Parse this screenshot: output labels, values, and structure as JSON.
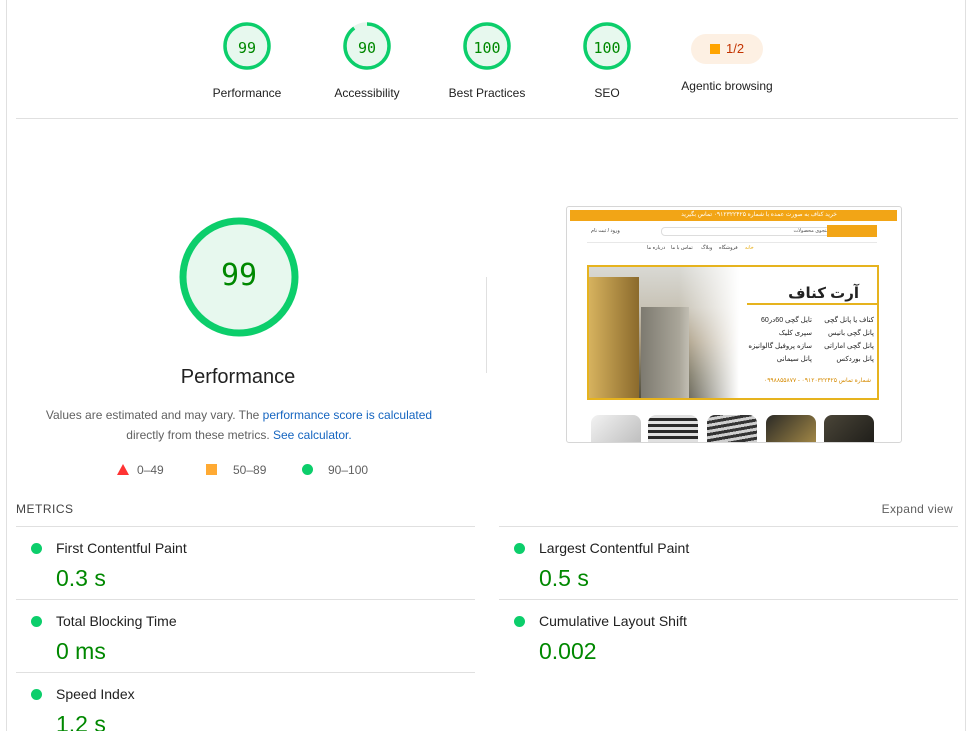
{
  "gauges": [
    {
      "score": "99",
      "label": "Performance",
      "color": "#0cce6b"
    },
    {
      "score": "90",
      "label": "Accessibility",
      "color": "#0cce6b"
    },
    {
      "score": "100",
      "label": "Best Practices",
      "color": "#0cce6b"
    },
    {
      "score": "100",
      "label": "SEO",
      "color": "#0cce6b"
    }
  ],
  "agentic": {
    "fraction": "1/2",
    "label": "Agentic browsing"
  },
  "main": {
    "score": "99",
    "title": "Performance",
    "note_prefix": "Values are estimated and may vary. The ",
    "note_link1": "performance score is calculated",
    "note_mid": "directly from these metrics. ",
    "note_link2": "See calculator.",
    "legend": [
      {
        "range": "0–49",
        "shape": "triangle",
        "color": "#ff3333"
      },
      {
        "range": "50–89",
        "shape": "square",
        "color": "#ffaa33"
      },
      {
        "range": "90–100",
        "shape": "circle",
        "color": "#0cce6b"
      }
    ]
  },
  "thumbnail": {
    "topbar_text": "خرید کناف به صورت عمده با شماره ۰۹۱۲۳۲۲۴۲۵ تماس بگیرید",
    "search_placeholder": "جستجوی محصولات",
    "login_text": "ورود / ثبت نام",
    "menu_items": [
      "خانه",
      "فروشگاه",
      "وبلاگ",
      "تماس با ما",
      "درباره ما"
    ],
    "brand": "آرت کناف",
    "lines_right": [
      "کناف یا پانل گچی",
      "پانل گچی بانیس",
      "پانل گچی اماراتی",
      "پانل بوردکس"
    ],
    "lines_left": [
      "تایل گچی 60در60",
      "سپری کلیک",
      "سازه پروفیل گالوانیزه",
      "پانل سیمانی"
    ],
    "phone": "شماره تماس ۰۹۱۲۰۳۲۲۴۲۵ - ۰۹۹۸۸۵۵۸۷۷"
  },
  "metrics_section": {
    "heading": "METRICS",
    "expand_label": "Expand view"
  },
  "metrics": [
    {
      "name": "First Contentful Paint",
      "value": "0.3 s",
      "status_color": "#0cce6b"
    },
    {
      "name": "Largest Contentful Paint",
      "value": "0.5 s",
      "status_color": "#0cce6b"
    },
    {
      "name": "Total Blocking Time",
      "value": "0 ms",
      "status_color": "#0cce6b"
    },
    {
      "name": "Cumulative Layout Shift",
      "value": "0.002",
      "status_color": "#0cce6b"
    },
    {
      "name": "Speed Index",
      "value": "1.2 s",
      "status_color": "#0cce6b"
    }
  ]
}
